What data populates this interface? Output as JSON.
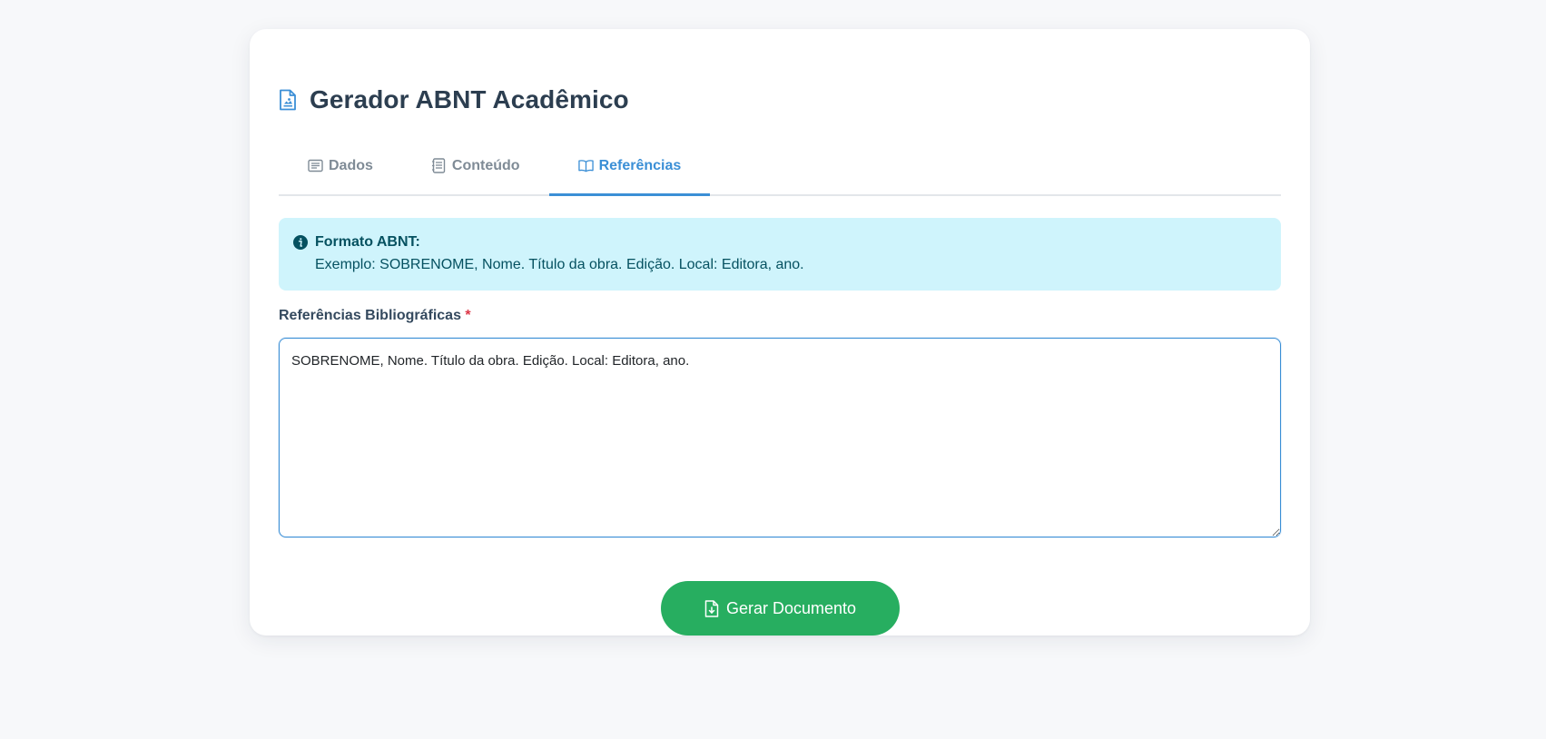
{
  "header": {
    "title": "Gerador ABNT Acadêmico",
    "icon": "document-icon"
  },
  "tabs": [
    {
      "label": "Dados",
      "icon": "list-icon",
      "active": false
    },
    {
      "label": "Conteúdo",
      "icon": "notes-icon",
      "active": false
    },
    {
      "label": "Referências",
      "icon": "book-icon",
      "active": true
    }
  ],
  "info_alert": {
    "title": "Formato ABNT:",
    "text": "Exemplo: SOBRENOME, Nome. Título da obra. Edição. Local: Editora, ano.",
    "icon": "info-icon"
  },
  "references_field": {
    "label": "Referências Bibliográficas",
    "required_mark": "*",
    "value": "SOBRENOME, Nome. Título da obra. Edição. Local: Editora, ano."
  },
  "actions": {
    "generate_label": "Gerar Documento",
    "generate_icon": "file-download-icon"
  },
  "colors": {
    "accent": "#3b8fd6",
    "success": "#27ae60",
    "info_bg": "#cff4fc",
    "info_text": "#055160",
    "required": "#dc3545"
  }
}
